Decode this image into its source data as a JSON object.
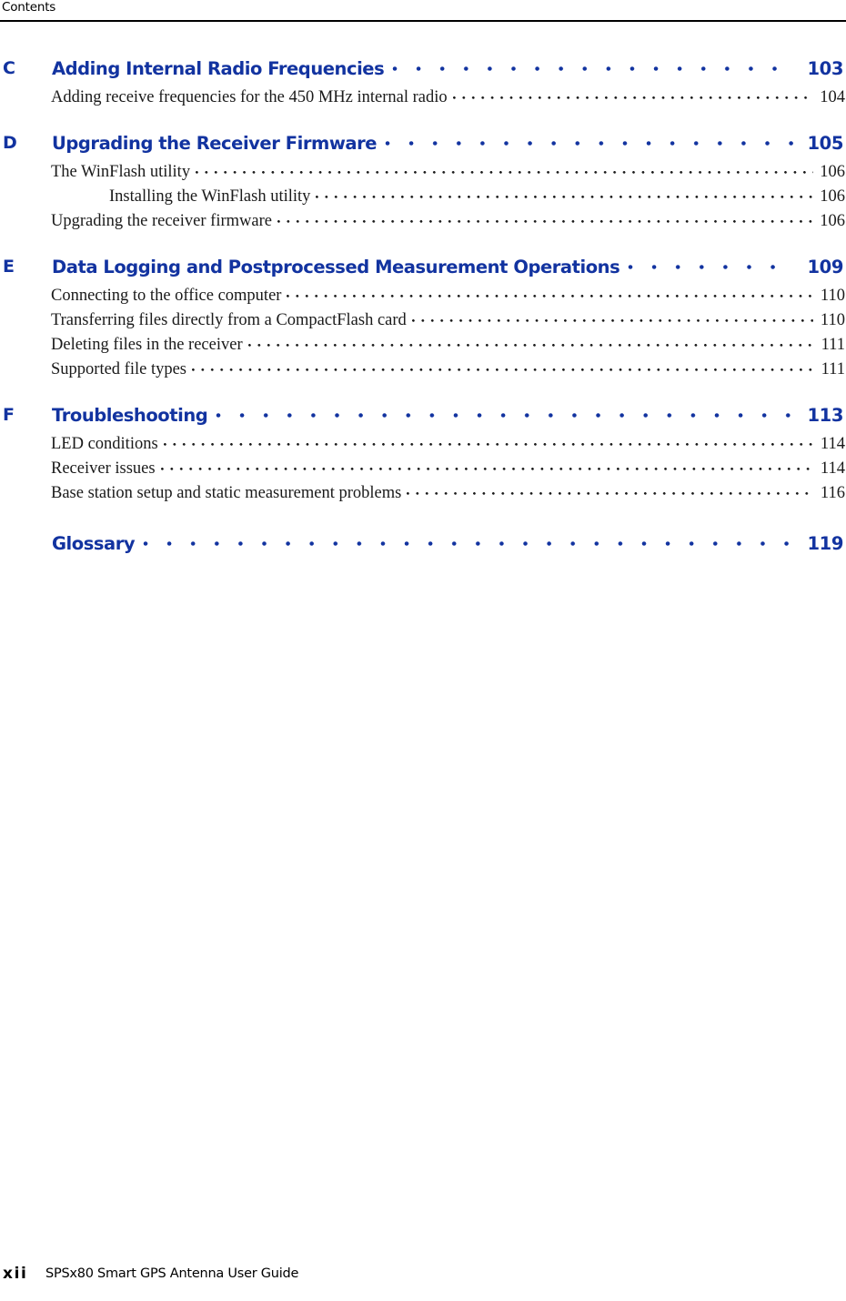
{
  "header": {
    "label": "Contents"
  },
  "colors": {
    "heading_blue": "#1233A0",
    "body_text": "#1a1a1a",
    "rule": "#000000"
  },
  "toc": {
    "entries": [
      {
        "level": 0,
        "letter": "C",
        "title": "Adding Internal Radio Frequencies",
        "page": "103"
      },
      {
        "level": 1,
        "letter": "",
        "title": "Adding receive frequencies for the 450 MHz internal radio",
        "page": "104"
      },
      {
        "level": 0,
        "letter": "D",
        "title": "Upgrading the Receiver Firmware",
        "page": "105"
      },
      {
        "level": 1,
        "letter": "",
        "title": "The WinFlash utility",
        "page": "106"
      },
      {
        "level": 2,
        "letter": "",
        "title": "Installing the WinFlash utility",
        "page": "106"
      },
      {
        "level": 1,
        "letter": "",
        "title": "Upgrading the receiver firmware",
        "page": "106"
      },
      {
        "level": 0,
        "letter": "E",
        "title": "Data Logging and Postprocessed Measurement Operations",
        "page": "109"
      },
      {
        "level": 1,
        "letter": "",
        "title": "Connecting to the office computer",
        "page": "110"
      },
      {
        "level": 1,
        "letter": "",
        "title": "Transferring files directly from a CompactFlash card",
        "page": "110"
      },
      {
        "level": 1,
        "letter": "",
        "title": "Deleting files in the receiver",
        "page": "111"
      },
      {
        "level": 1,
        "letter": "",
        "title": "Supported file types",
        "page": "111"
      },
      {
        "level": 0,
        "letter": "F",
        "title": "Troubleshooting",
        "page": "113"
      },
      {
        "level": 1,
        "letter": "",
        "title": "LED conditions",
        "page": "114"
      },
      {
        "level": 1,
        "letter": "",
        "title": "Receiver issues",
        "page": "114"
      },
      {
        "level": 1,
        "letter": "",
        "title": "Base station setup and static measurement problems",
        "page": "116"
      },
      {
        "level": 0,
        "letter": "",
        "title": "Glossary",
        "page": "119"
      }
    ]
  },
  "footer": {
    "folio": "xii",
    "title": "SPSx80 Smart GPS Antenna User Guide"
  }
}
